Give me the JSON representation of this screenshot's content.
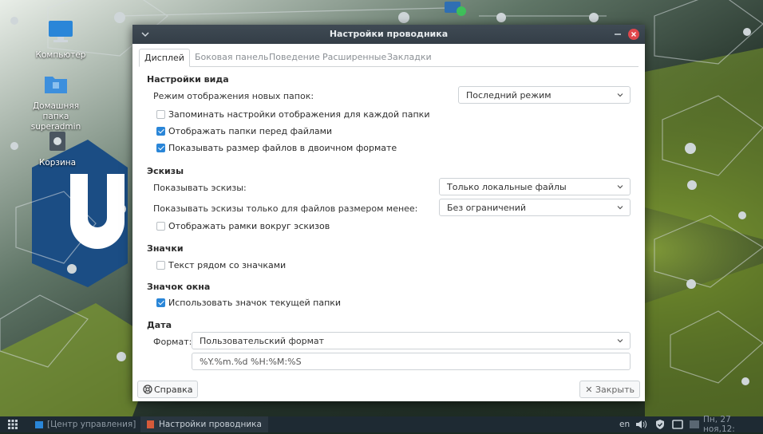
{
  "desktop": {
    "icons": [
      {
        "label": "Компьютер"
      },
      {
        "label": "Домашняя папка superadmin"
      },
      {
        "label": "Корзина"
      }
    ],
    "brand_letters": "UE"
  },
  "dialog": {
    "title": "Настройки проводника",
    "tabs": [
      {
        "label": "Дисплей",
        "active": true
      },
      {
        "label": "Боковая панель",
        "active": false
      },
      {
        "label": "Поведение",
        "active": false
      },
      {
        "label": "Расширенные",
        "active": false
      },
      {
        "label": "Закладки",
        "active": false
      }
    ],
    "view_settings": {
      "title": "Настройки вида",
      "new_folders_label": "Режим отображения новых папок:",
      "new_folders_value": "Последний режим",
      "remember_per_folder": {
        "label": "Запоминать настройки отображения для каждой папки",
        "checked": false
      },
      "folders_first": {
        "label": "Отображать папки перед файлами",
        "checked": true
      },
      "binary_size": {
        "label": "Показывать размер файлов в двоичном формате",
        "checked": true
      }
    },
    "thumbnails": {
      "title": "Эскизы",
      "show_label": "Показывать эскизы:",
      "show_value": "Только локальные файлы",
      "max_size_label": "Показывать эскизы только для файлов размером менее:",
      "max_size_value": "Без ограничений",
      "frames": {
        "label": "Отображать рамки вокруг эскизов",
        "checked": false
      }
    },
    "icons": {
      "title": "Значки",
      "text_beside": {
        "label": "Текст рядом со значками",
        "checked": false
      }
    },
    "window_icon": {
      "title": "Значок окна",
      "use_folder_icon": {
        "label": "Использовать значок текущей папки",
        "checked": true
      }
    },
    "date": {
      "title": "Дата",
      "format_label": "Формат:",
      "format_value": "Пользовательский формат",
      "custom_format": "%Y.%m.%d %H:%M:%S"
    },
    "help_label": "Справка",
    "close_label": "✕ Закрыть"
  },
  "taskbar": {
    "items": [
      {
        "label": "[Центр управления]"
      },
      {
        "label": "Настройки проводника"
      }
    ],
    "lang": "en",
    "clock": "Пн, 27 ноя,12:"
  },
  "colors": {
    "accent": "#2a86d8",
    "titlebar": "#3a444d",
    "close_red": "#e0474c",
    "taskbar": "#1e2a33"
  }
}
